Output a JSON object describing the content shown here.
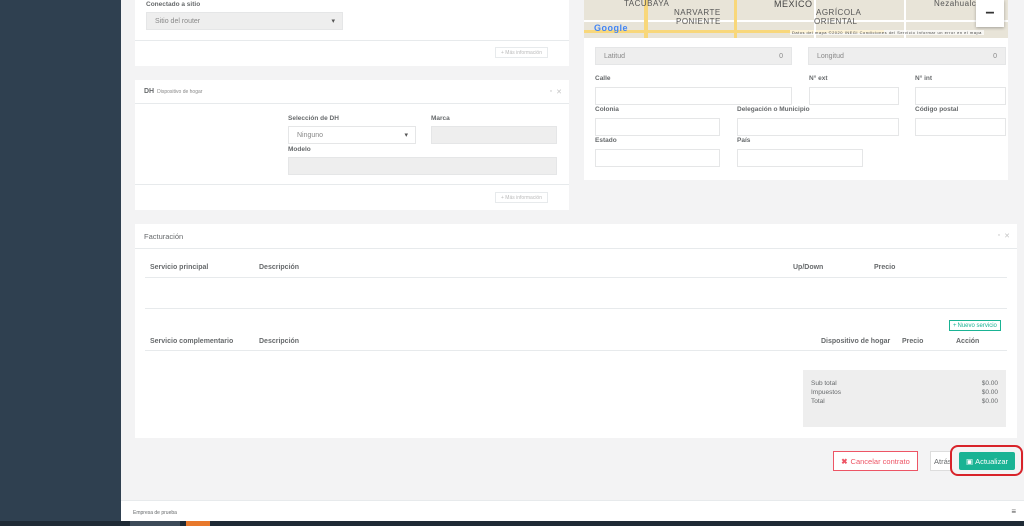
{
  "site_section": {
    "connected_label": "Conectado a sitio",
    "site_select_value": "Sitio del router",
    "more_info": "+ Más información"
  },
  "dh_section": {
    "title": "DH",
    "subtitle": "Dispositivo de hogar",
    "selection_label": "Selección de DH",
    "selection_value": "Ninguno",
    "brand_label": "Marca",
    "model_label": "Modelo",
    "more_info": "+ Más información"
  },
  "map": {
    "places": [
      "TACUBAYA",
      "MÉXICO",
      "NARVARTE",
      "PONIENTE",
      "AGRÍCOLA",
      "ORIENTAL",
      "Nezahualcóy",
      "Google"
    ],
    "attribution": "Datos del mapa ©2020 INEGI  Condiciones del Servicio  Informar un error en el mapa"
  },
  "address": {
    "lat_label": "Latitud",
    "lat_value": "0",
    "lng_label": "Longitud",
    "lng_value": "0",
    "street": "Calle",
    "ext": "N° ext",
    "int": "N° int",
    "colonia": "Colonia",
    "delegacion": "Delegación o Municipio",
    "postal": "Código postal",
    "state": "Estado",
    "country": "País"
  },
  "billing": {
    "title": "Facturación",
    "main_headers": [
      "Servicio principal",
      "Descripción",
      "Up/Down",
      "Precio"
    ],
    "new_service": "Nuevo servicio",
    "comp_headers": [
      "Servicio complementario",
      "Descripción",
      "Dispositivo de hogar",
      "Precio",
      "Acción"
    ],
    "subtotal_label": "Sub total",
    "subtotal_value": "$0.00",
    "tax_label": "Impuestos",
    "tax_value": "$0.00",
    "total_label": "Total",
    "total_value": "$0.00"
  },
  "actions": {
    "cancel": "Cancelar contrato",
    "back": "Atrás",
    "update": "Actualizar"
  },
  "footer": {
    "company": "Empresa de prueba"
  },
  "colors": {
    "sidebar": "#2f4050",
    "primary": "#1ab394",
    "danger": "#ed5565",
    "highlight": "#d8232a"
  }
}
